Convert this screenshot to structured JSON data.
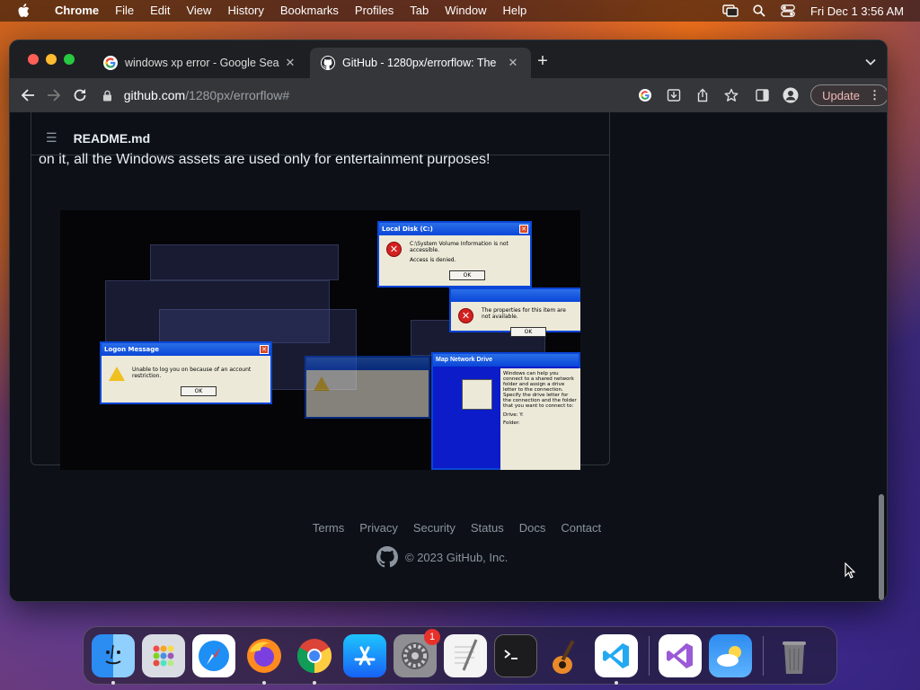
{
  "menubar": {
    "items": [
      "Chrome",
      "File",
      "Edit",
      "View",
      "History",
      "Bookmarks",
      "Profiles",
      "Tab",
      "Window",
      "Help"
    ],
    "clock": "Fri Dec 1  3:56 AM"
  },
  "tabs": [
    {
      "title": "windows xp error - Google Sea",
      "favicon": "google-g-icon",
      "active": false
    },
    {
      "title": "GitHub - 1280px/errorflow: The",
      "favicon": "github-icon",
      "active": true
    }
  ],
  "omnibox": {
    "host": "github.com",
    "path": "/1280px/errorflow#"
  },
  "toolbar": {
    "update_label": "Update"
  },
  "readme": {
    "title": "README.md",
    "text": "on it, all the Windows assets are used only for entertainment purposes!"
  },
  "collage": {
    "dialogs": [
      {
        "title": "Local Disk (C:)",
        "line1": "C:\\System Volume Information is not accessible.",
        "line2": "Access is denied.",
        "ok": "OK"
      },
      {
        "title": "Logon Message",
        "line1": "Unable to log you on because of an account restriction.",
        "ok": "OK"
      },
      {
        "title": "",
        "line1": "The properties for this item are not available.",
        "ok": "OK"
      },
      {
        "title": "Map Network Drive",
        "panel_text": "Windows can help you connect to a shared network folder and assign a drive letter to the connection. Specify the drive letter for the connection and the folder that you want to connect to:",
        "drive_label": "Drive:",
        "drive_value": "Y:",
        "folder_label": "Folder:"
      }
    ]
  },
  "footer": {
    "links": [
      "Terms",
      "Privacy",
      "Security",
      "Status",
      "Docs",
      "Contact"
    ],
    "copyright": "© 2023 GitHub, Inc."
  },
  "dock": {
    "apps": [
      "Finder",
      "Launchpad",
      "Safari",
      "Firefox",
      "Chrome",
      "App Store",
      "System Settings",
      "TextEdit",
      "Terminal",
      "GarageBand",
      "Visual Studio Code",
      "Visual Studio",
      "Weather",
      "Trash"
    ],
    "settings_badge": "1"
  },
  "colors": {
    "github_bg": "#0d1117",
    "xp_title": "#0a46d8",
    "update_text": "#f0b8b8"
  }
}
